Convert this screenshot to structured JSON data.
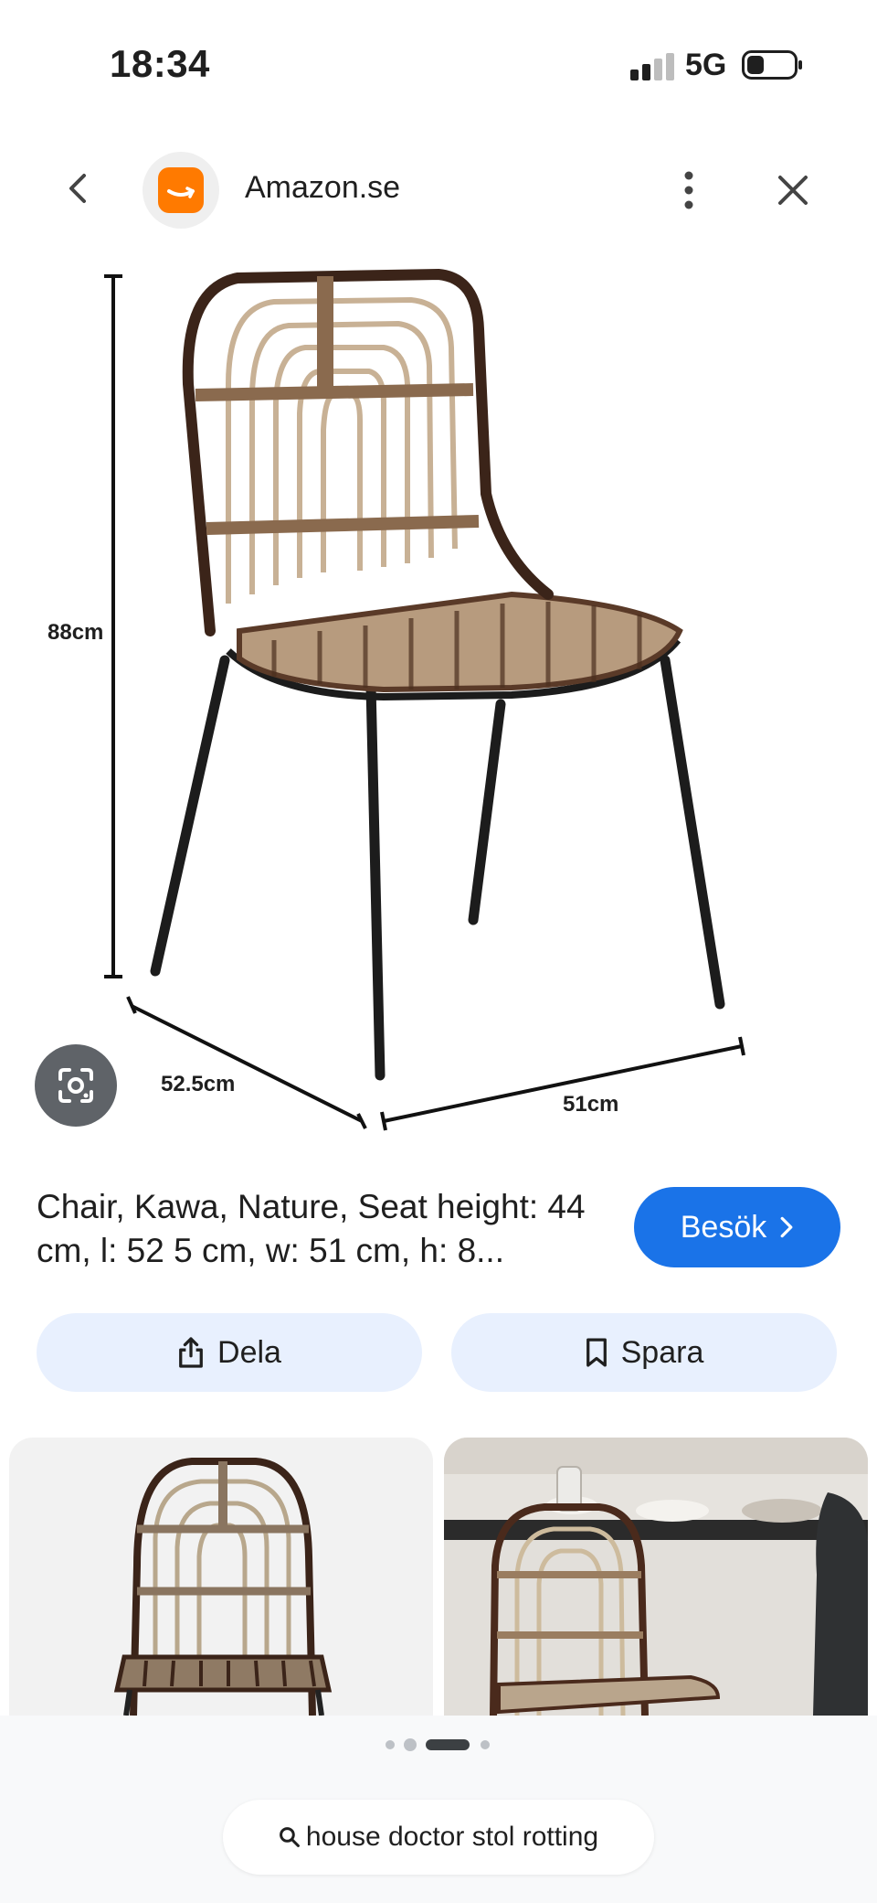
{
  "status_bar": {
    "time": "18:34",
    "network": "5G"
  },
  "header": {
    "site_name": "Amazon.se"
  },
  "dimensions": {
    "height": "88cm",
    "depth": "52.5cm",
    "width": "51cm"
  },
  "product": {
    "title": "Chair, Kawa, Nature, Seat height: 44 cm, l: 52 5 cm, w: 51 cm, h: 8..."
  },
  "actions": {
    "visit_label": "Besök",
    "share_label": "Dela",
    "save_label": "Spara"
  },
  "pager": {
    "count": 4,
    "active_index": 2
  },
  "search": {
    "query": "house doctor stol rotting"
  },
  "colors": {
    "accent": "#1a73e8",
    "chip_bg": "#e8f0fe",
    "amazon_orange": "#ff7a00"
  },
  "icons": [
    "chevron-left-icon",
    "amazon-logo-icon",
    "more-vert-icon",
    "close-icon",
    "google-lens-icon",
    "share-icon",
    "bookmark-icon",
    "chevron-right-icon",
    "search-icon",
    "signal-icon",
    "battery-icon"
  ]
}
